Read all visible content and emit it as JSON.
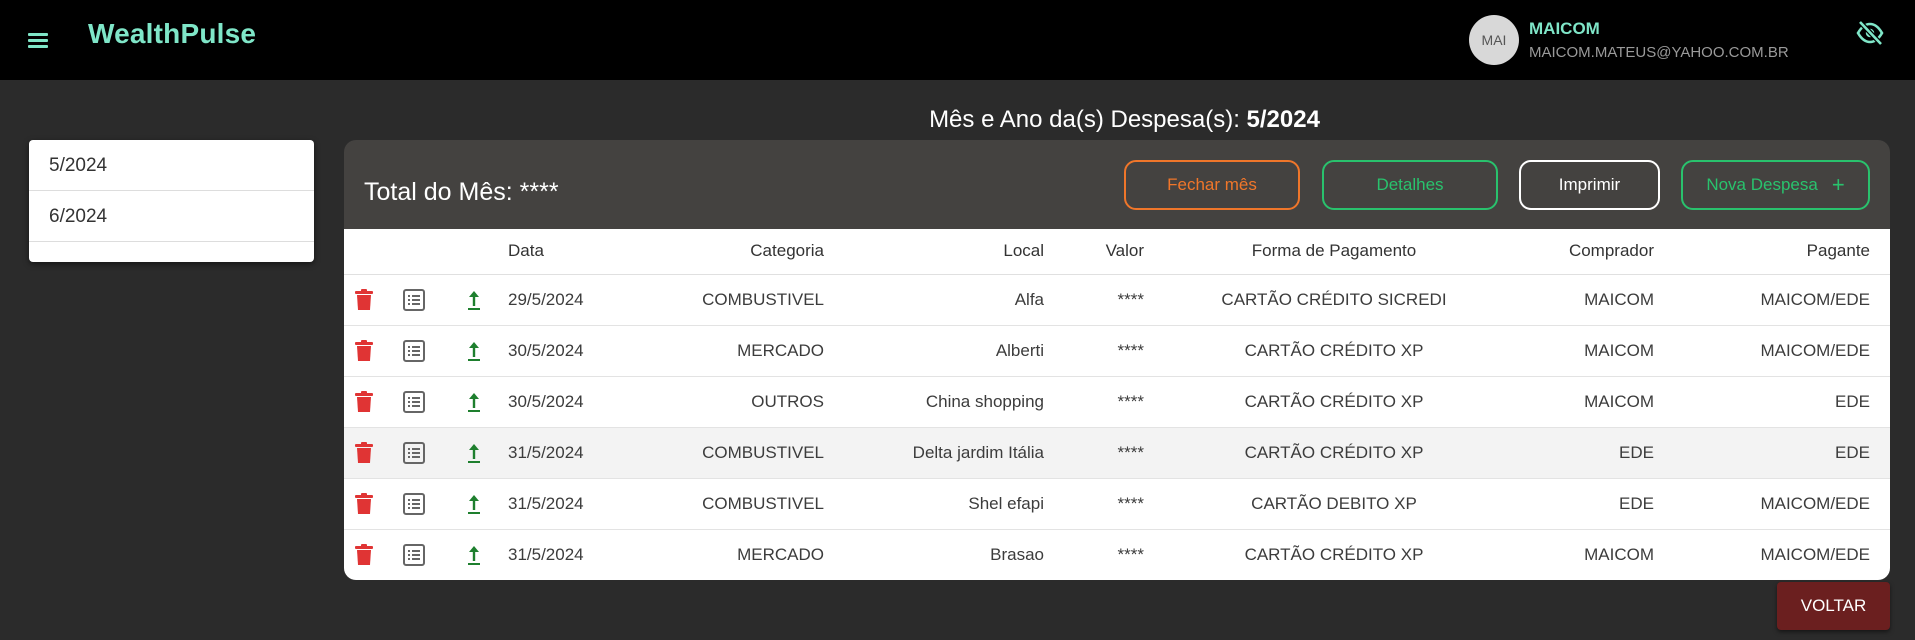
{
  "app": {
    "brand": "WealthPulse"
  },
  "user": {
    "avatar_initials": "MAI",
    "name": "MAICOM",
    "email": "MAICOM.MATEUS@YAHOO.COM.BR"
  },
  "heading": {
    "label": "Mês e Ano da(s) Despesa(s):",
    "value": "5/2024"
  },
  "months": [
    "5/2024",
    "6/2024"
  ],
  "panel": {
    "total_label": "Total do Mês: ****",
    "buttons": {
      "fechar": "Fechar mês",
      "detalhes": "Detalhes",
      "imprimir": "Imprimir",
      "nova": "Nova Despesa",
      "nova_icon": "+"
    }
  },
  "table": {
    "headers": [
      "Data",
      "Categoria",
      "Local",
      "Valor",
      "Forma de Pagamento",
      "Comprador",
      "Pagante"
    ],
    "rows": [
      {
        "data": "29/5/2024",
        "categoria": "COMBUSTIVEL",
        "local": "Alfa",
        "valor": "****",
        "forma": "CARTÃO CRÉDITO SICREDI",
        "comprador": "MAICOM",
        "pagante": "MAICOM/EDE"
      },
      {
        "data": "30/5/2024",
        "categoria": "MERCADO",
        "local": "Alberti",
        "valor": "****",
        "forma": "CARTÃO CRÉDITO XP",
        "comprador": "MAICOM",
        "pagante": "MAICOM/EDE"
      },
      {
        "data": "30/5/2024",
        "categoria": "OUTROS",
        "local": "China shopping",
        "valor": "****",
        "forma": "CARTÃO CRÉDITO XP",
        "comprador": "MAICOM",
        "pagante": "EDE"
      },
      {
        "data": "31/5/2024",
        "categoria": "COMBUSTIVEL",
        "local": "Delta jardim Itália",
        "valor": "****",
        "forma": "CARTÃO CRÉDITO XP",
        "comprador": "EDE",
        "pagante": "EDE"
      },
      {
        "data": "31/5/2024",
        "categoria": "COMBUSTIVEL",
        "local": "Shel efapi",
        "valor": "****",
        "forma": "CARTÃO DEBITO XP",
        "comprador": "EDE",
        "pagante": "MAICOM/EDE"
      },
      {
        "data": "31/5/2024",
        "categoria": "MERCADO",
        "local": "Brasao",
        "valor": "****",
        "forma": "CARTÃO CRÉDITO XP",
        "comprador": "MAICOM",
        "pagante": "MAICOM/EDE"
      }
    ],
    "row_icons": [
      "delete-icon",
      "details-list-icon",
      "upload-arrow-icon"
    ]
  },
  "footer": {
    "back_label": "VOLTAR"
  },
  "colors": {
    "accent": "#7fe6c8",
    "orange": "#f0762a",
    "green": "#29c26d",
    "delete": "#e03434",
    "upload": "#1e7f2e",
    "voltar_bg": "#6b1f1f"
  }
}
